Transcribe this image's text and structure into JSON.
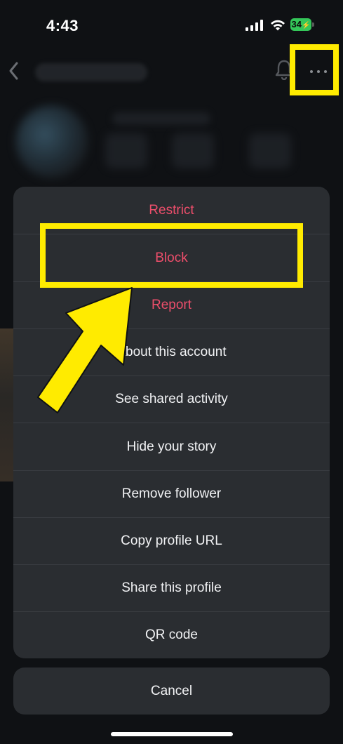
{
  "status_bar": {
    "time": "4:43",
    "battery_level": "34"
  },
  "colors": {
    "highlight": "#ffeb00",
    "danger": "#ed4e6b",
    "sheet_background": "#2a2d31",
    "page_background": "#0f1114"
  },
  "header": {
    "back_icon": "chevron-left-icon",
    "notification_icon": "bell-icon",
    "more_icon": "ellipsis-icon"
  },
  "action_sheet": {
    "items": [
      {
        "label": "Restrict",
        "style": "danger"
      },
      {
        "label": "Block",
        "style": "danger"
      },
      {
        "label": "Report",
        "style": "danger"
      },
      {
        "label": "About this account",
        "style": "default"
      },
      {
        "label": "See shared activity",
        "style": "default"
      },
      {
        "label": "Hide your story",
        "style": "default"
      },
      {
        "label": "Remove follower",
        "style": "default"
      },
      {
        "label": "Copy profile URL",
        "style": "default"
      },
      {
        "label": "Share this profile",
        "style": "default"
      },
      {
        "label": "QR code",
        "style": "default"
      }
    ],
    "cancel_label": "Cancel"
  },
  "annotations": {
    "highlighted_item": "Block",
    "arrow_icon": "pointer-arrow-icon"
  }
}
